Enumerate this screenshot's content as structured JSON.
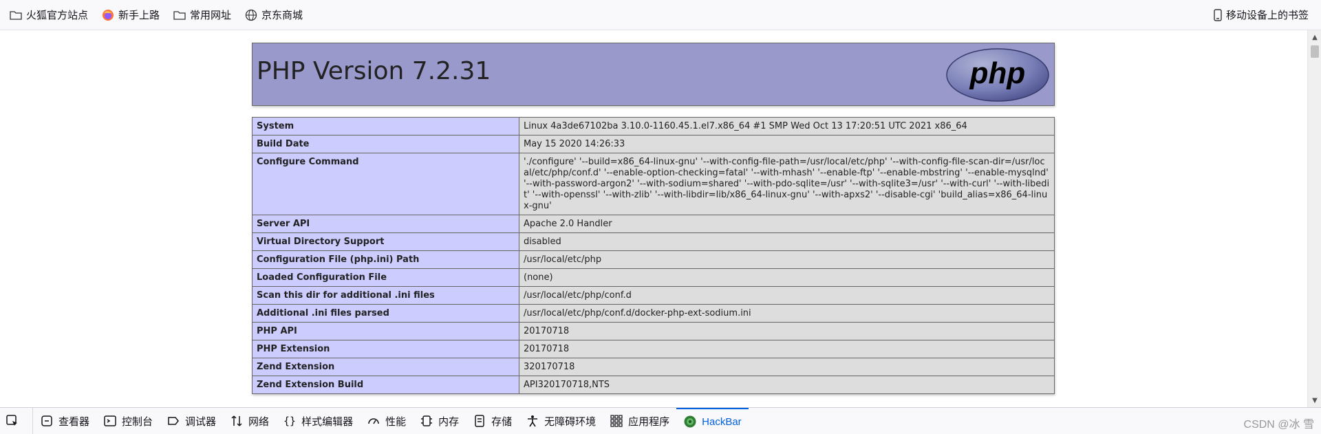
{
  "bookmarks": {
    "items": [
      {
        "label": "火狐官方站点",
        "icon": "folder-icon"
      },
      {
        "label": "新手上路",
        "icon": "firefox-icon"
      },
      {
        "label": "常用网址",
        "icon": "folder-icon"
      },
      {
        "label": "京东商城",
        "icon": "globe-icon"
      }
    ],
    "mobile": {
      "label": "移动设备上的书签",
      "icon": "mobile-icon"
    }
  },
  "phpinfo": {
    "title": "PHP Version 7.2.31",
    "logo_text": "php",
    "rows": [
      {
        "key": "System",
        "value": "Linux 4a3de67102ba 3.10.0-1160.45.1.el7.x86_64 #1 SMP Wed Oct 13 17:20:51 UTC 2021 x86_64"
      },
      {
        "key": "Build Date",
        "value": "May 15 2020 14:26:33"
      },
      {
        "key": "Configure Command",
        "value": "'./configure' '--build=x86_64-linux-gnu' '--with-config-file-path=/usr/local/etc/php' '--with-config-file-scan-dir=/usr/local/etc/php/conf.d' '--enable-option-checking=fatal' '--with-mhash' '--enable-ftp' '--enable-mbstring' '--enable-mysqlnd' '--with-password-argon2' '--with-sodium=shared' '--with-pdo-sqlite=/usr' '--with-sqlite3=/usr' '--with-curl' '--with-libedit' '--with-openssl' '--with-zlib' '--with-libdir=lib/x86_64-linux-gnu' '--with-apxs2' '--disable-cgi' 'build_alias=x86_64-linux-gnu'"
      },
      {
        "key": "Server API",
        "value": "Apache 2.0 Handler"
      },
      {
        "key": "Virtual Directory Support",
        "value": "disabled"
      },
      {
        "key": "Configuration File (php.ini) Path",
        "value": "/usr/local/etc/php"
      },
      {
        "key": "Loaded Configuration File",
        "value": "(none)"
      },
      {
        "key": "Scan this dir for additional .ini files",
        "value": "/usr/local/etc/php/conf.d"
      },
      {
        "key": "Additional .ini files parsed",
        "value": "/usr/local/etc/php/conf.d/docker-php-ext-sodium.ini"
      },
      {
        "key": "PHP API",
        "value": "20170718"
      },
      {
        "key": "PHP Extension",
        "value": "20170718"
      },
      {
        "key": "Zend Extension",
        "value": "320170718"
      },
      {
        "key": "Zend Extension Build",
        "value": "API320170718,NTS"
      }
    ]
  },
  "devtools": {
    "tabs": [
      {
        "label": "查看器",
        "icon": "inspector-icon"
      },
      {
        "label": "控制台",
        "icon": "console-icon"
      },
      {
        "label": "调试器",
        "icon": "debugger-icon"
      },
      {
        "label": "网络",
        "icon": "network-icon"
      },
      {
        "label": "样式编辑器",
        "icon": "style-editor-icon"
      },
      {
        "label": "性能",
        "icon": "performance-icon"
      },
      {
        "label": "内存",
        "icon": "memory-icon"
      },
      {
        "label": "存储",
        "icon": "storage-icon"
      },
      {
        "label": "无障碍环境",
        "icon": "accessibility-icon"
      },
      {
        "label": "应用程序",
        "icon": "application-icon"
      },
      {
        "label": "HackBar",
        "icon": "hackbar-icon"
      }
    ],
    "active_tab": "HackBar",
    "watermark": "CSDN @冰 雪"
  },
  "colors": {
    "header": "#9999cc",
    "key_cell": "#ccccff",
    "value_cell": "#dddddd",
    "accent": "#0060df"
  }
}
